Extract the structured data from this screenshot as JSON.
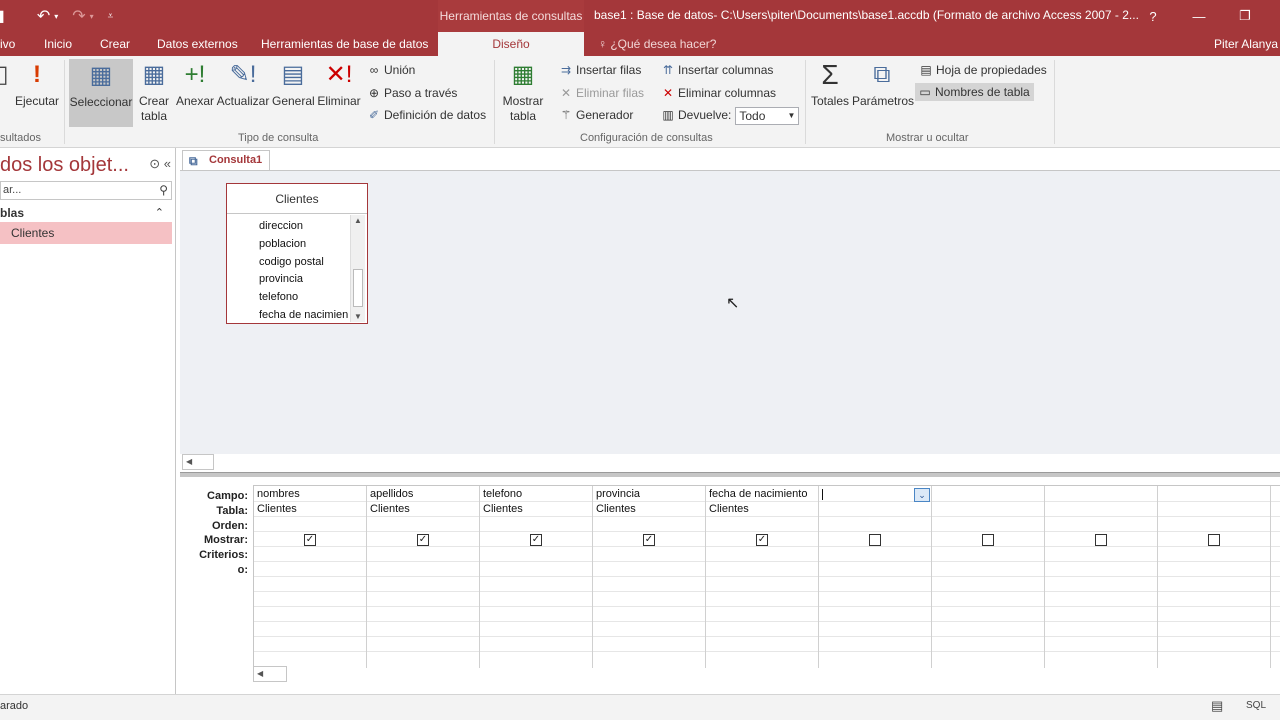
{
  "window": {
    "context_tab_title": "Herramientas de consultas",
    "title": "base1 : Base de datos- C:\\Users\\piter\\Documents\\base1.accdb (Formato de archivo Access 2007 - 2...",
    "help": "?",
    "minimize": "—",
    "restore": "❐"
  },
  "tabs": [
    {
      "label": "ivo"
    },
    {
      "label": "Inicio"
    },
    {
      "label": "Crear"
    },
    {
      "label": "Datos externos"
    },
    {
      "label": "Herramientas de base de datos"
    },
    {
      "label": "Diseño"
    }
  ],
  "tell_me": "¿Qué desea hacer?",
  "user": "Piter Alanya",
  "ribbon": {
    "ejecutar": "Ejecutar",
    "resultados_label": "sultados",
    "seleccionar": "Seleccionar",
    "crear_tabla": "Crear tabla",
    "anexar": "Anexar",
    "actualizar": "Actualizar",
    "general": "General",
    "eliminar": "Eliminar",
    "union": "Unión",
    "paso_traves": "Paso a través",
    "definicion_datos": "Definición de datos",
    "tipo_consulta_label": "Tipo de consulta",
    "mostrar_tabla": "Mostrar tabla",
    "insertar_filas": "Insertar filas",
    "eliminar_filas": "Eliminar filas",
    "generador": "Generador",
    "insertar_columnas": "Insertar columnas",
    "eliminar_columnas": "Eliminar columnas",
    "devuelve": "Devuelve:",
    "devuelve_value": "Todo",
    "config_label": "Configuración de consultas",
    "totales": "Totales",
    "parametros": "Parámetros",
    "hoja_propiedades": "Hoja de propiedades",
    "nombres_tabla": "Nombres de tabla",
    "mostrar_ocultar_label": "Mostrar u ocultar"
  },
  "nav": {
    "header": "dos los objet...",
    "search_placeholder": "ar...",
    "group": "blas",
    "item": "Clientes"
  },
  "doc": {
    "tab_label": "Consulta1"
  },
  "table_box": {
    "title": "Clientes",
    "fields": [
      "direccion",
      "poblacion",
      "codigo postal",
      "provincia",
      "telefono",
      "fecha de nacimien"
    ]
  },
  "grid": {
    "row_labels": {
      "campo": "Campo:",
      "tabla": "Tabla:",
      "orden": "Orden:",
      "mostrar": "Mostrar:",
      "criterios": "Criterios:",
      "o": "o:"
    },
    "columns": [
      {
        "campo": "nombres",
        "tabla": "Clientes",
        "mostrar": true
      },
      {
        "campo": "apellidos",
        "tabla": "Clientes",
        "mostrar": true
      },
      {
        "campo": "telefono",
        "tabla": "Clientes",
        "mostrar": true
      },
      {
        "campo": "provincia",
        "tabla": "Clientes",
        "mostrar": true
      },
      {
        "campo": "fecha de nacimiento",
        "tabla": "Clientes",
        "mostrar": true
      },
      {
        "campo": "",
        "tabla": "",
        "mostrar": false
      },
      {
        "campo": "",
        "tabla": "",
        "mostrar": false
      },
      {
        "campo": "",
        "tabla": "",
        "mostrar": false
      },
      {
        "campo": "",
        "tabla": "",
        "mostrar": false
      }
    ]
  },
  "status": {
    "text": "arado",
    "view_sql": "SQL"
  },
  "colors": {
    "accent": "#a4373a",
    "nav_selected": "#f5c1c4",
    "design_bg": "#eef0f4"
  }
}
